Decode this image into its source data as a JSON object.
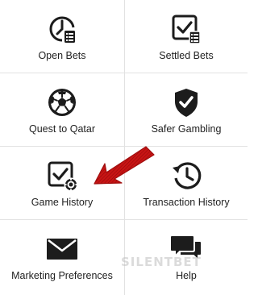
{
  "menu": {
    "items": [
      {
        "label": "Open Bets",
        "icon": "open-bets-icon"
      },
      {
        "label": "Settled Bets",
        "icon": "settled-bets-icon"
      },
      {
        "label": "Quest to Qatar",
        "icon": "soccer-ball-icon"
      },
      {
        "label": "Safer Gambling",
        "icon": "shield-check-icon"
      },
      {
        "label": "Game History",
        "icon": "game-history-icon"
      },
      {
        "label": "Transaction History",
        "icon": "history-clock-icon"
      },
      {
        "label": "Marketing Preferences",
        "icon": "envelope-icon"
      },
      {
        "label": "Help",
        "icon": "chat-bubbles-icon"
      }
    ]
  },
  "annotation": {
    "type": "arrow",
    "color": "#d01818",
    "icon": "red-arrow-icon"
  },
  "watermark": {
    "text": "SILENTBET"
  }
}
